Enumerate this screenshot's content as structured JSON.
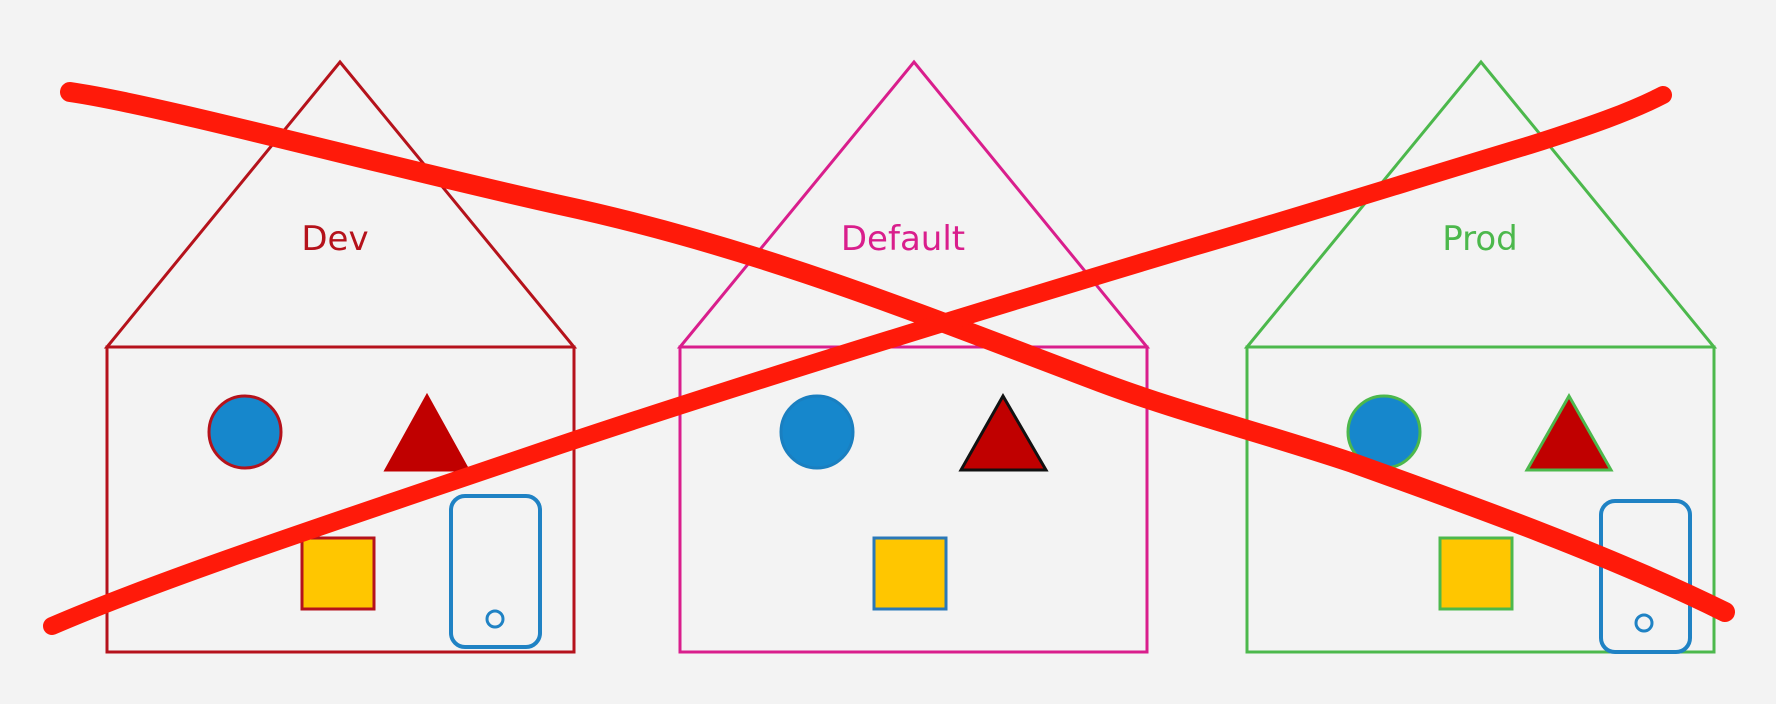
{
  "houses": [
    {
      "label": "Dev",
      "color": "#b5121b",
      "circle_stroke": "#b5121b",
      "triangle_stroke": "#c00000",
      "square_stroke": "#b5121b",
      "has_phone": true
    },
    {
      "label": "Default",
      "color": "#d91e8c",
      "circle_stroke": "#1a7fc0",
      "triangle_stroke": "#111111",
      "square_stroke": "#2a78b8",
      "has_phone": false
    },
    {
      "label": "Prod",
      "color": "#4cb84c",
      "circle_stroke": "#4cb84c",
      "triangle_stroke": "#4cb84c",
      "square_stroke": "#4cb84c",
      "has_phone": true
    }
  ],
  "colors": {
    "background": "#f3f3f3",
    "circle_fill": "#1687cc",
    "triangle_fill": "#c00000",
    "square_fill": "#ffc600",
    "phone_stroke": "#1f82c4",
    "cross_stroke": "#ff1a0a"
  }
}
